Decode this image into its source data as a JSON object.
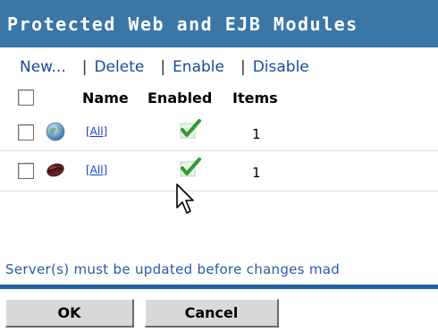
{
  "title": "Protected Web and EJB Modules",
  "toolbar": {
    "new_label": "New...",
    "delete_label": "Delete",
    "enable_label": "Enable",
    "disable_label": "Disable",
    "separator": "|"
  },
  "table": {
    "headers": {
      "name": "Name",
      "enabled": "Enabled",
      "items": "Items"
    },
    "rows": [
      {
        "type_icon": "globe-icon",
        "name": "[All]",
        "enabled": true,
        "items": "1"
      },
      {
        "type_icon": "coffee-bean-icon",
        "name": "[All]",
        "enabled": true,
        "items": "1"
      }
    ]
  },
  "status": "Server(s) must be updated before changes mad",
  "buttons": {
    "ok": "OK",
    "cancel": "Cancel"
  },
  "colors": {
    "title_bg": "#3a76a6",
    "link": "#1a4a9a",
    "check_green": "#2e9b2e",
    "rule": "#1e5fa3"
  }
}
